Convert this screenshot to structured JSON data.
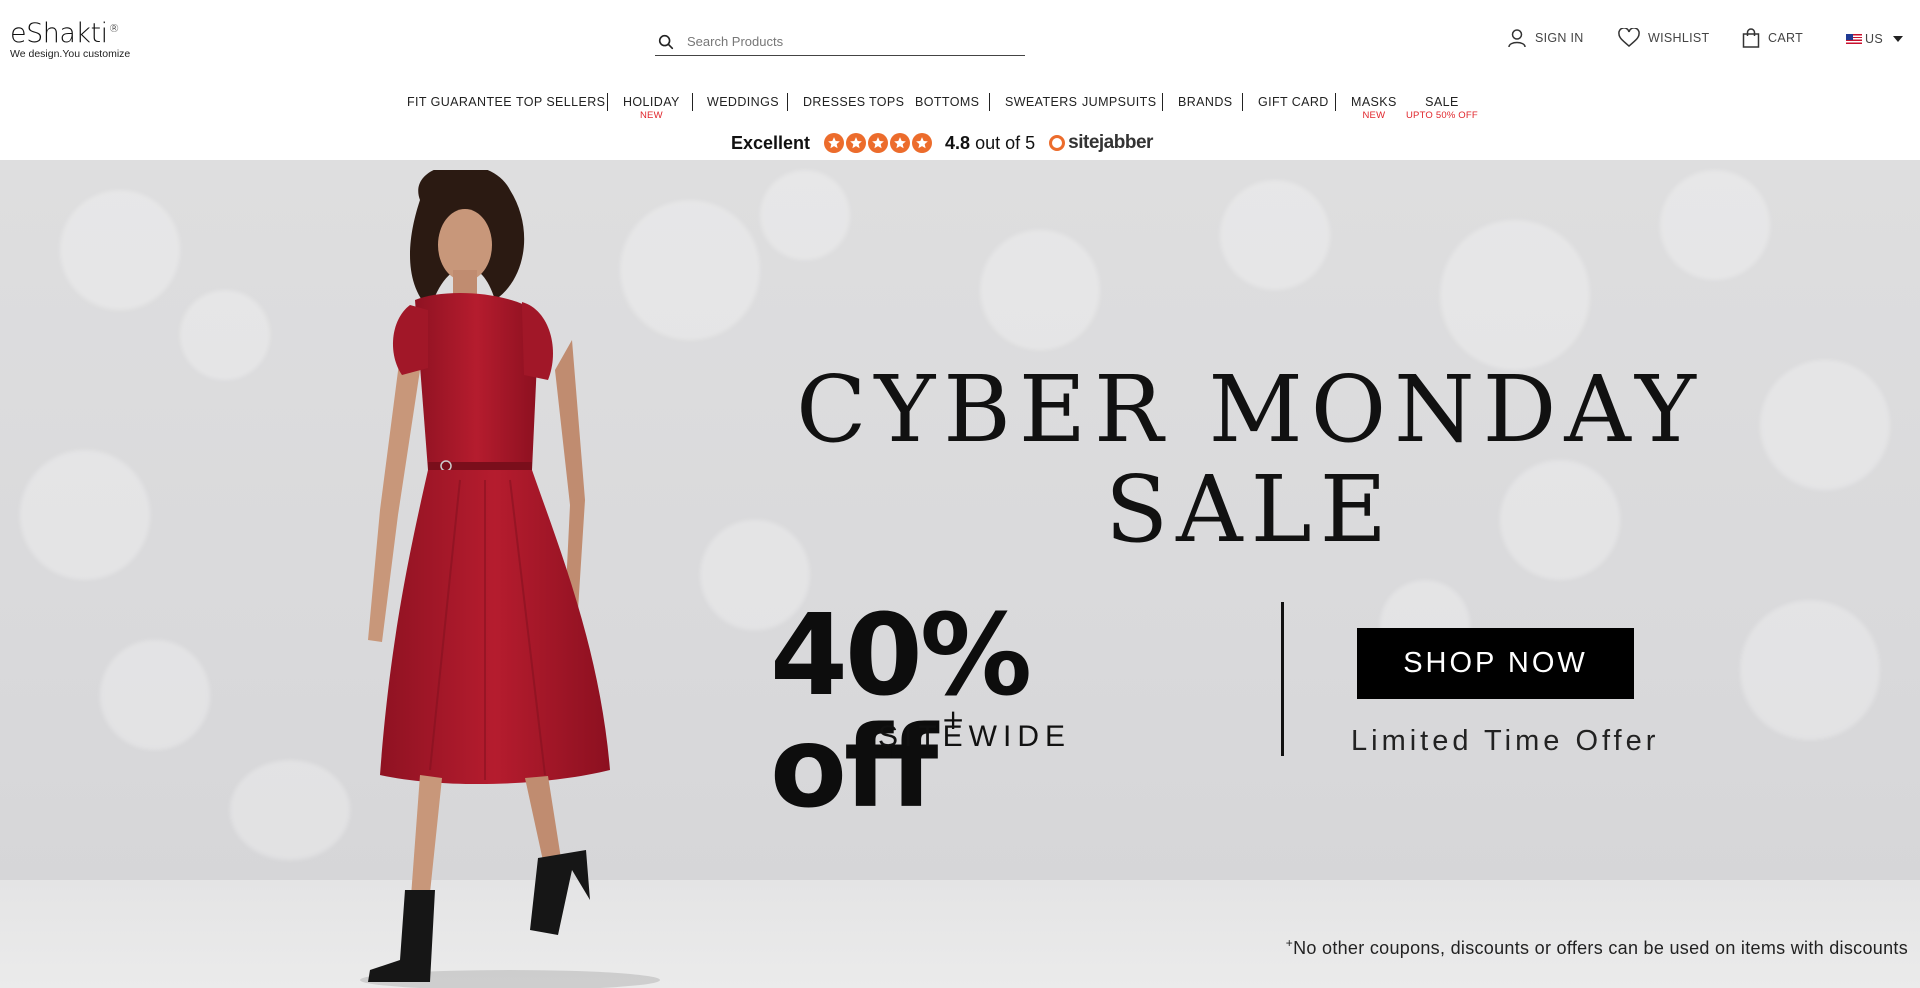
{
  "brand": {
    "name": "eShakti",
    "registered": "®",
    "tagline": "We design.You customize"
  },
  "search": {
    "placeholder": "Search Products"
  },
  "utility": {
    "sign_in": "SIGN IN",
    "wishlist": "WISHLIST",
    "cart": "CART",
    "country": "US"
  },
  "nav": {
    "items": [
      {
        "label": "FIT GUARANTEE",
        "sub": ""
      },
      {
        "label": "TOP SELLERS",
        "sub": ""
      },
      {
        "label": "HOLIDAY",
        "sub": "NEW"
      },
      {
        "label": "WEDDINGS",
        "sub": ""
      },
      {
        "label": "DRESSES",
        "sub": ""
      },
      {
        "label": "TOPS",
        "sub": ""
      },
      {
        "label": "BOTTOMS",
        "sub": ""
      },
      {
        "label": "SWEATERS",
        "sub": ""
      },
      {
        "label": "JUMPSUITS",
        "sub": ""
      },
      {
        "label": "BRANDS",
        "sub": ""
      },
      {
        "label": "GIFT CARD",
        "sub": ""
      },
      {
        "label": "MASKS",
        "sub": "NEW"
      },
      {
        "label": "SALE",
        "sub": "UPTO 50% OFF"
      }
    ]
  },
  "rating": {
    "label": "Excellent",
    "score": "4.8",
    "out_of": "out of 5",
    "stars": 5,
    "provider": "sitejabber"
  },
  "hero": {
    "title_line1": "CYBER MONDAY",
    "title_line2": "SALE",
    "discount": "40% off",
    "discount_mark": "+",
    "sitewide": "SITEWIDE",
    "cta": "SHOP NOW",
    "limited": "Limited Time Offer",
    "disclaimer_mark": "+",
    "disclaimer": "No other coupons, discounts or offers can be used on items with discounts"
  },
  "colors": {
    "accent_red": "#e0252b",
    "star_orange": "#ec6c2c",
    "dress_red": "#a8182a",
    "cta_bg": "#000000"
  },
  "icons": [
    "search-icon",
    "user-icon",
    "heart-icon",
    "bag-icon",
    "us-flag-icon",
    "chevron-down-icon",
    "star-icon"
  ]
}
